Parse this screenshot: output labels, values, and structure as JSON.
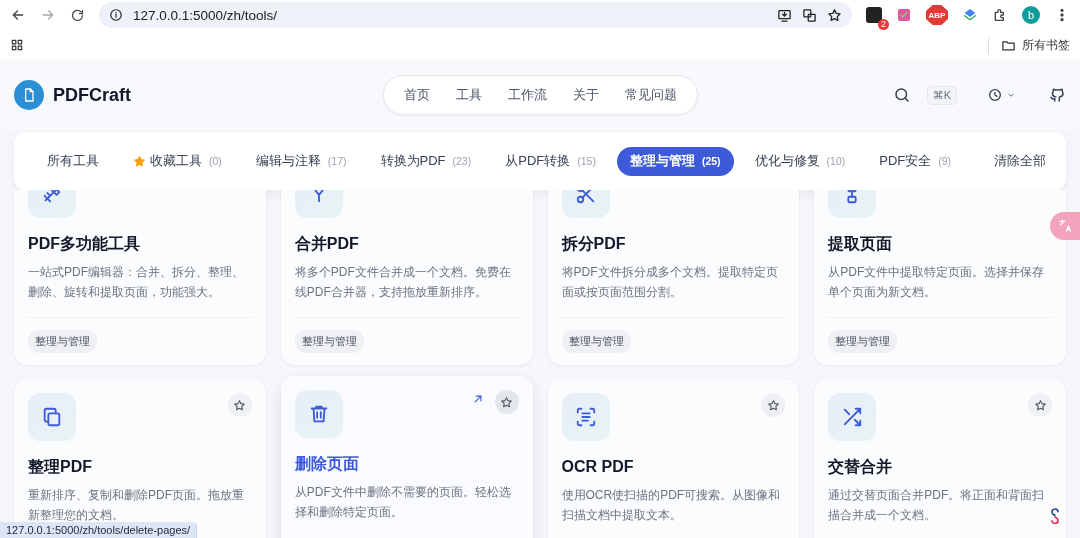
{
  "browser": {
    "url": "127.0.0.1:5000/zh/tools/",
    "extension_badge": "2",
    "adblock_label": "ABP",
    "profile_initial": "b",
    "bookmarks_label": "所有书签"
  },
  "header": {
    "brand": "PDFCraft",
    "nav": [
      "首页",
      "工具",
      "工作流",
      "关于",
      "常见问题"
    ],
    "shortcut": "⌘K"
  },
  "filters": [
    {
      "kind": "all",
      "label": "所有工具",
      "selected": false
    },
    {
      "kind": "favorites",
      "label": "收藏工具",
      "count": "(0)",
      "selected": false
    },
    {
      "kind": "category",
      "label": "编辑与注释",
      "count": "(17)",
      "selected": false
    },
    {
      "kind": "category",
      "label": "转换为PDF",
      "count": "(23)",
      "selected": false
    },
    {
      "kind": "category",
      "label": "从PDF转换",
      "count": "(15)",
      "selected": false
    },
    {
      "kind": "category",
      "label": "整理与管理",
      "count": "(25)",
      "selected": true
    },
    {
      "kind": "category",
      "label": "优化与修复",
      "count": "(10)",
      "selected": false
    },
    {
      "kind": "category",
      "label": "PDF安全",
      "count": "(9)",
      "selected": false
    }
  ],
  "clear_label": "清除全部",
  "tools": [
    {
      "kind": "multi",
      "title": "PDF多功能工具",
      "description": "一站式PDF编辑器：合并、拆分、整理、删除、旋转和提取页面，功能强大。",
      "tag": "整理与管理",
      "hovered": false
    },
    {
      "kind": "merge",
      "title": "合并PDF",
      "description": "将多个PDF文件合并成一个文档。免费在线PDF合并器，支持拖放重新排序。",
      "tag": "整理与管理",
      "hovered": false
    },
    {
      "kind": "split",
      "title": "拆分PDF",
      "description": "将PDF文件拆分成多个文档。提取特定页面或按页面范围分割。",
      "tag": "整理与管理",
      "hovered": false
    },
    {
      "kind": "extract",
      "title": "提取页面",
      "description": "从PDF文件中提取特定页面。选择并保存单个页面为新文档。",
      "tag": "整理与管理",
      "hovered": false
    },
    {
      "kind": "organize",
      "title": "整理PDF",
      "description": "重新排序、复制和删除PDF页面。拖放重新整理您的文档。",
      "hovered": false
    },
    {
      "kind": "delete",
      "title": "删除页面",
      "description": "从PDF文件中删除不需要的页面。轻松选择和删除特定页面。",
      "hovered": true
    },
    {
      "kind": "ocr",
      "title": "OCR PDF",
      "description": "使用OCR使扫描的PDF可搜索。从图像和扫描文档中提取文本。",
      "hovered": false
    },
    {
      "kind": "alternate",
      "title": "交替合并",
      "description": "通过交替页面合并PDF。将正面和背面扫描合并成一个文档。",
      "hovered": false
    }
  ],
  "status_url": "127.0.0.1:5000/zh/tools/delete-pages/"
}
